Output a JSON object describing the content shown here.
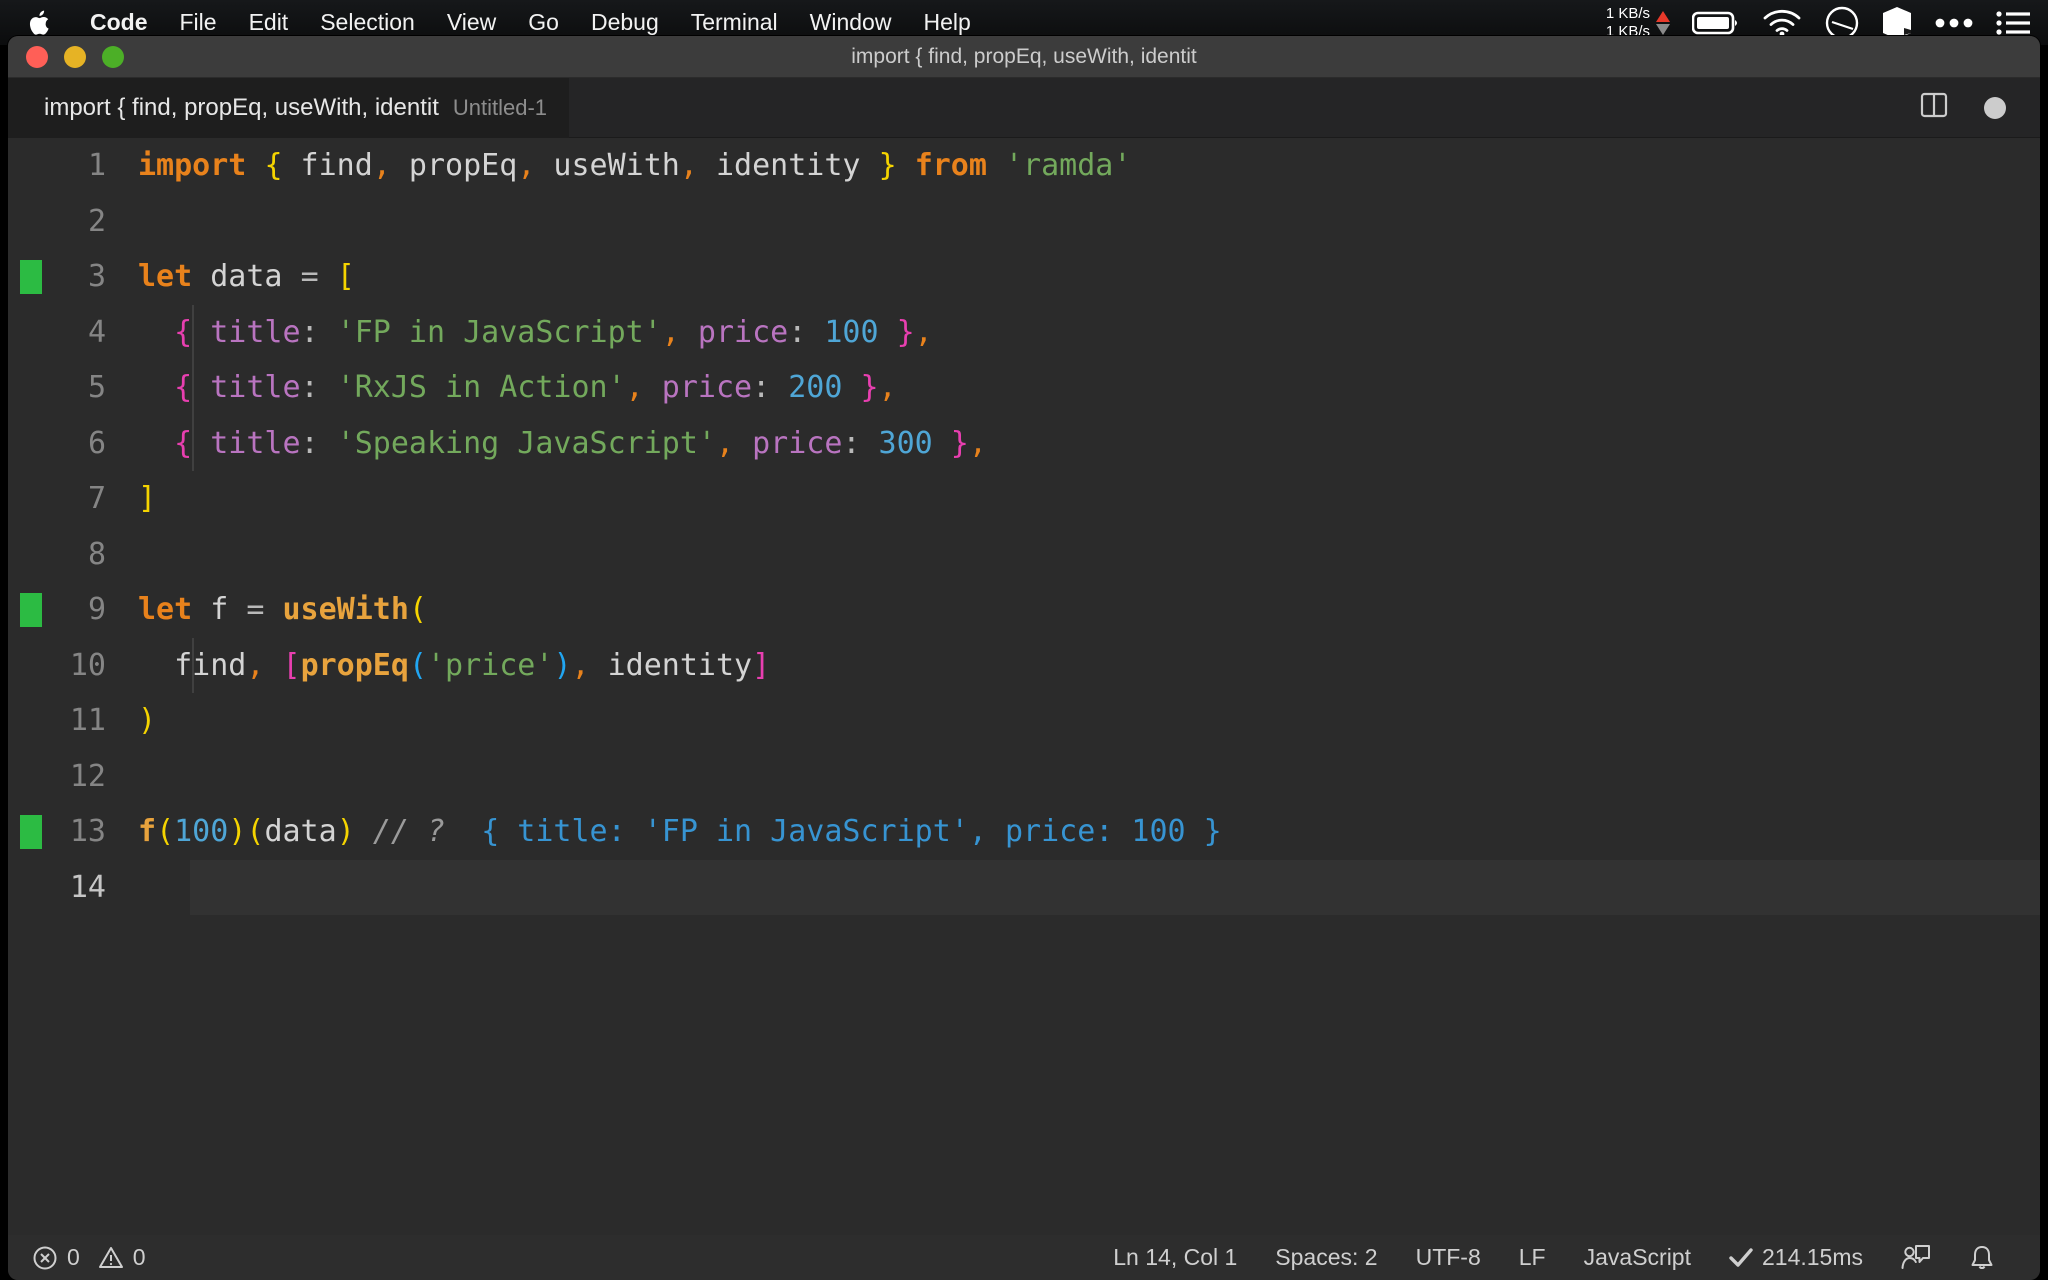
{
  "menubar": {
    "apple_icon": "apple-logo",
    "items": [
      {
        "label": "Code",
        "bold": true
      },
      {
        "label": "File",
        "bold": false
      },
      {
        "label": "Edit",
        "bold": false
      },
      {
        "label": "Selection",
        "bold": false
      },
      {
        "label": "View",
        "bold": false
      },
      {
        "label": "Go",
        "bold": false
      },
      {
        "label": "Debug",
        "bold": false
      },
      {
        "label": "Terminal",
        "bold": false
      },
      {
        "label": "Window",
        "bold": false
      },
      {
        "label": "Help",
        "bold": false
      }
    ],
    "status": {
      "net_up": "1 KB/s",
      "net_down": "1 KB/s",
      "icons": [
        "battery-icon",
        "wifi-icon",
        "do-not-disturb-icon",
        "cube-icon",
        "ellipsis-icon",
        "list-icon"
      ]
    },
    "accent_up_color": "#e8392a",
    "accent_down_color": "#8b8b8b"
  },
  "window": {
    "title": "import { find, propEq, useWith, identit",
    "traffic_lights": [
      "close-button",
      "minimize-button",
      "maximize-button"
    ]
  },
  "tab": {
    "label": "import { find, propEq, useWith, identit",
    "description": "Untitled-1",
    "actions": [
      "split-editor-icon",
      "unsaved-dot-icon"
    ]
  },
  "editor": {
    "language_color_number": "#4fa6d6",
    "language_color_string": "#73a95c",
    "gutter_change_color": "#2cbb43",
    "active_line": 14,
    "lines": [
      {
        "n": "1",
        "deco": false,
        "indent": false,
        "tokens": [
          {
            "t": "import",
            "c": "t-kw"
          },
          {
            "t": " ",
            "c": "t-var"
          },
          {
            "t": "{",
            "c": "t-br-y"
          },
          {
            "t": " find",
            "c": "t-var"
          },
          {
            "t": ",",
            "c": "t-punc"
          },
          {
            "t": " propEq",
            "c": "t-var"
          },
          {
            "t": ",",
            "c": "t-punc"
          },
          {
            "t": " useWith",
            "c": "t-var"
          },
          {
            "t": ",",
            "c": "t-punc"
          },
          {
            "t": " identity ",
            "c": "t-var"
          },
          {
            "t": "}",
            "c": "t-br-y"
          },
          {
            "t": " ",
            "c": "t-var"
          },
          {
            "t": "from",
            "c": "t-kw"
          },
          {
            "t": " ",
            "c": "t-var"
          },
          {
            "t": "'ramda'",
            "c": "t-str"
          }
        ]
      },
      {
        "n": "2",
        "deco": false,
        "indent": false,
        "tokens": []
      },
      {
        "n": "3",
        "deco": true,
        "indent": false,
        "tokens": [
          {
            "t": "let",
            "c": "t-kw"
          },
          {
            "t": " ",
            "c": "t-var"
          },
          {
            "t": "data",
            "c": "t-var"
          },
          {
            "t": " ",
            "c": "t-var"
          },
          {
            "t": "=",
            "c": "t-op"
          },
          {
            "t": " ",
            "c": "t-var"
          },
          {
            "t": "[",
            "c": "t-br-y"
          }
        ]
      },
      {
        "n": "4",
        "deco": false,
        "indent": true,
        "tokens": [
          {
            "t": "  ",
            "c": "t-var"
          },
          {
            "t": "{",
            "c": "t-br-p"
          },
          {
            "t": " ",
            "c": "t-var"
          },
          {
            "t": "title",
            "c": "t-prop"
          },
          {
            "t": ":",
            "c": "t-op"
          },
          {
            "t": " ",
            "c": "t-var"
          },
          {
            "t": "'FP in JavaScript'",
            "c": "t-str"
          },
          {
            "t": ",",
            "c": "t-punc"
          },
          {
            "t": " ",
            "c": "t-var"
          },
          {
            "t": "price",
            "c": "t-prop"
          },
          {
            "t": ":",
            "c": "t-op"
          },
          {
            "t": " ",
            "c": "t-var"
          },
          {
            "t": "100",
            "c": "t-num"
          },
          {
            "t": " ",
            "c": "t-var"
          },
          {
            "t": "}",
            "c": "t-br-p"
          },
          {
            "t": ",",
            "c": "t-punc"
          }
        ]
      },
      {
        "n": "5",
        "deco": false,
        "indent": true,
        "tokens": [
          {
            "t": "  ",
            "c": "t-var"
          },
          {
            "t": "{",
            "c": "t-br-p"
          },
          {
            "t": " ",
            "c": "t-var"
          },
          {
            "t": "title",
            "c": "t-prop"
          },
          {
            "t": ":",
            "c": "t-op"
          },
          {
            "t": " ",
            "c": "t-var"
          },
          {
            "t": "'RxJS in Action'",
            "c": "t-str"
          },
          {
            "t": ",",
            "c": "t-punc"
          },
          {
            "t": " ",
            "c": "t-var"
          },
          {
            "t": "price",
            "c": "t-prop"
          },
          {
            "t": ":",
            "c": "t-op"
          },
          {
            "t": " ",
            "c": "t-var"
          },
          {
            "t": "200",
            "c": "t-num"
          },
          {
            "t": " ",
            "c": "t-var"
          },
          {
            "t": "}",
            "c": "t-br-p"
          },
          {
            "t": ",",
            "c": "t-punc"
          }
        ]
      },
      {
        "n": "6",
        "deco": false,
        "indent": true,
        "tokens": [
          {
            "t": "  ",
            "c": "t-var"
          },
          {
            "t": "{",
            "c": "t-br-p"
          },
          {
            "t": " ",
            "c": "t-var"
          },
          {
            "t": "title",
            "c": "t-prop"
          },
          {
            "t": ":",
            "c": "t-op"
          },
          {
            "t": " ",
            "c": "t-var"
          },
          {
            "t": "'Speaking JavaScript'",
            "c": "t-str"
          },
          {
            "t": ",",
            "c": "t-punc"
          },
          {
            "t": " ",
            "c": "t-var"
          },
          {
            "t": "price",
            "c": "t-prop"
          },
          {
            "t": ":",
            "c": "t-op"
          },
          {
            "t": " ",
            "c": "t-var"
          },
          {
            "t": "300",
            "c": "t-num"
          },
          {
            "t": " ",
            "c": "t-var"
          },
          {
            "t": "}",
            "c": "t-br-p"
          },
          {
            "t": ",",
            "c": "t-punc"
          }
        ]
      },
      {
        "n": "7",
        "deco": false,
        "indent": false,
        "tokens": [
          {
            "t": "]",
            "c": "t-br-y"
          }
        ]
      },
      {
        "n": "8",
        "deco": false,
        "indent": false,
        "tokens": []
      },
      {
        "n": "9",
        "deco": true,
        "indent": false,
        "tokens": [
          {
            "t": "let",
            "c": "t-kw"
          },
          {
            "t": " ",
            "c": "t-var"
          },
          {
            "t": "f",
            "c": "t-var"
          },
          {
            "t": " ",
            "c": "t-var"
          },
          {
            "t": "=",
            "c": "t-op"
          },
          {
            "t": " ",
            "c": "t-var"
          },
          {
            "t": "useWith",
            "c": "t-fn"
          },
          {
            "t": "(",
            "c": "t-br-y"
          }
        ]
      },
      {
        "n": "10",
        "deco": false,
        "indent": true,
        "tokens": [
          {
            "t": "  ",
            "c": "t-var"
          },
          {
            "t": "find",
            "c": "t-var"
          },
          {
            "t": ",",
            "c": "t-punc"
          },
          {
            "t": " ",
            "c": "t-var"
          },
          {
            "t": "[",
            "c": "t-br-p"
          },
          {
            "t": "propEq",
            "c": "t-fn"
          },
          {
            "t": "(",
            "c": "t-br-b"
          },
          {
            "t": "'price'",
            "c": "t-str"
          },
          {
            "t": ")",
            "c": "t-br-b"
          },
          {
            "t": ",",
            "c": "t-punc"
          },
          {
            "t": " identity",
            "c": "t-var"
          },
          {
            "t": "]",
            "c": "t-br-p"
          }
        ]
      },
      {
        "n": "11",
        "deco": false,
        "indent": false,
        "tokens": [
          {
            "t": ")",
            "c": "t-br-y"
          }
        ]
      },
      {
        "n": "12",
        "deco": false,
        "indent": false,
        "tokens": []
      },
      {
        "n": "13",
        "deco": true,
        "indent": false,
        "tokens": [
          {
            "t": "f",
            "c": "t-fn"
          },
          {
            "t": "(",
            "c": "t-br-y"
          },
          {
            "t": "100",
            "c": "t-num"
          },
          {
            "t": ")",
            "c": "t-br-y"
          },
          {
            "t": "(",
            "c": "t-br-y"
          },
          {
            "t": "data",
            "c": "t-var"
          },
          {
            "t": ")",
            "c": "t-br-y"
          },
          {
            "t": " ",
            "c": "t-var"
          },
          {
            "t": "// ?",
            "c": "t-cmt"
          },
          {
            "t": "  ",
            "c": "t-var"
          },
          {
            "t": "{ title: 'FP in JavaScript', price: 100 }",
            "c": "t-res"
          }
        ]
      },
      {
        "n": "14",
        "deco": false,
        "indent": false,
        "tokens": []
      }
    ]
  },
  "statusbar": {
    "errors_icon": "error-circle-icon",
    "errors": "0",
    "warnings_icon": "warning-triangle-icon",
    "warnings": "0",
    "cursor_position": "Ln 14, Col 1",
    "indentation": "Spaces: 2",
    "encoding": "UTF-8",
    "eol": "LF",
    "language": "JavaScript",
    "run_time": "214.15ms",
    "run_status_icon": "checkmark-icon",
    "feedback_icon": "feedback-person-icon",
    "notifications_icon": "bell-icon"
  }
}
